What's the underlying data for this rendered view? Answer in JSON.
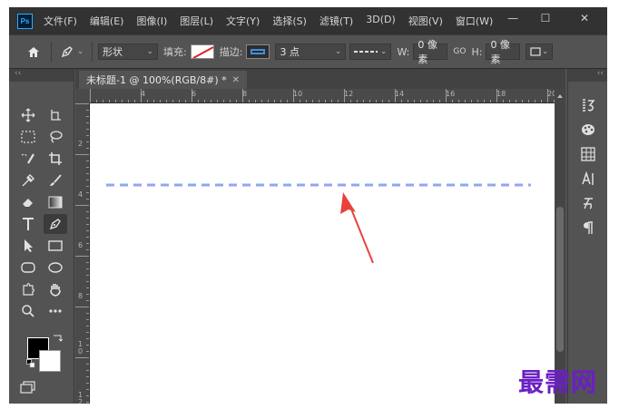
{
  "app": {
    "logo": "Ps",
    "menu": [
      "文件(F)",
      "编辑(E)",
      "图像(I)",
      "图层(L)",
      "文字(Y)",
      "选择(S)",
      "滤镜(T)",
      "3D(D)",
      "视图(V)",
      "窗口(W)"
    ],
    "window_controls": {
      "minimize": "—",
      "maximize": "☐",
      "close": "✕"
    }
  },
  "options": {
    "mode_value": "形状",
    "fill_label": "填充:",
    "stroke_label": "描边:",
    "stroke_width": "3 点",
    "w_label": "W:",
    "w_value": "0 像素",
    "link_icon": "GO",
    "h_label": "H:",
    "h_value": "0 像素",
    "stroke_color": "#4a8ef0"
  },
  "panels": {
    "left_collapse": "‹‹",
    "right_collapse": "‹‹"
  },
  "document": {
    "tab_title": "未标题-1 @ 100%(RGB/8#) *",
    "tab_close": "✕",
    "ruler_h": [
      "4",
      "6",
      "8",
      "10",
      "12",
      "14",
      "16",
      "18",
      "20"
    ],
    "ruler_v": [
      "2",
      "4",
      "6",
      "8",
      "1\n0",
      "1\n2"
    ],
    "dashed_line_color": "#8fa8ee",
    "arrow_color": "#e8433b"
  },
  "watermark": "最需网"
}
